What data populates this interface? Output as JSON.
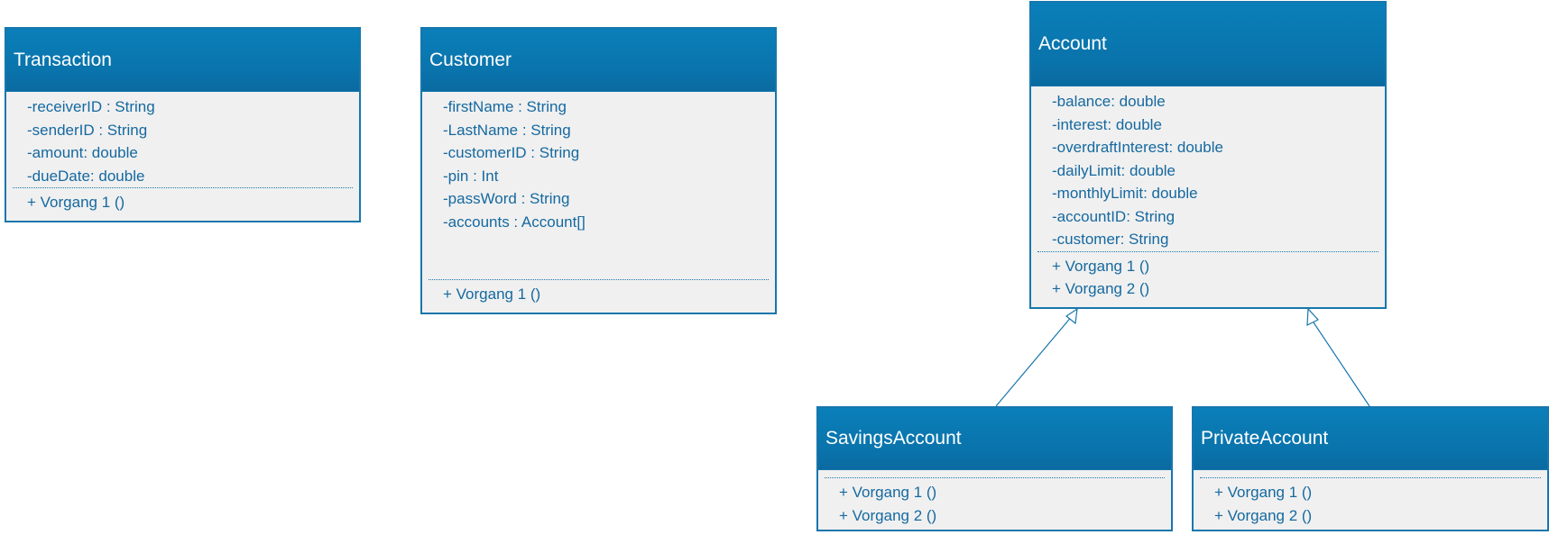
{
  "classes": {
    "transaction": {
      "name": "Transaction",
      "attributes": [
        "-receiverID : String",
        "-senderID : String",
        "-amount: double",
        "-dueDate: double"
      ],
      "operations": [
        "+ Vorgang 1 ()"
      ]
    },
    "customer": {
      "name": "Customer",
      "attributes": [
        "-firstName : String",
        "-LastName : String",
        "-customerID : String",
        "-pin : Int",
        "-passWord : String",
        "-accounts : Account[]"
      ],
      "operations": [
        "+ Vorgang 1 ()"
      ]
    },
    "account": {
      "name": "Account",
      "attributes": [
        "-balance: double",
        "-interest: double",
        "-overdraftInterest: double",
        "-dailyLimit: double",
        "-monthlyLimit: double",
        "-accountID: String",
        "-customer: String"
      ],
      "operations": [
        "+ Vorgang 1 ()",
        "+ Vorgang 2 ()"
      ]
    },
    "savingsAccount": {
      "name": "SavingsAccount",
      "attributes": [],
      "operations": [
        "+ Vorgang 1 ()",
        "+ Vorgang 2 ()"
      ]
    },
    "privateAccount": {
      "name": "PrivateAccount",
      "attributes": [],
      "operations": [
        "+ Vorgang 1 ()",
        "+ Vorgang 2 ()"
      ]
    }
  },
  "relations": [
    {
      "type": "generalization",
      "from": "savingsAccount",
      "to": "account"
    },
    {
      "type": "generalization",
      "from": "privateAccount",
      "to": "account"
    }
  ],
  "colors": {
    "header": "#0a78b2",
    "border": "#1777ad",
    "text": "#1569a0",
    "body": "#f0f0f0"
  }
}
